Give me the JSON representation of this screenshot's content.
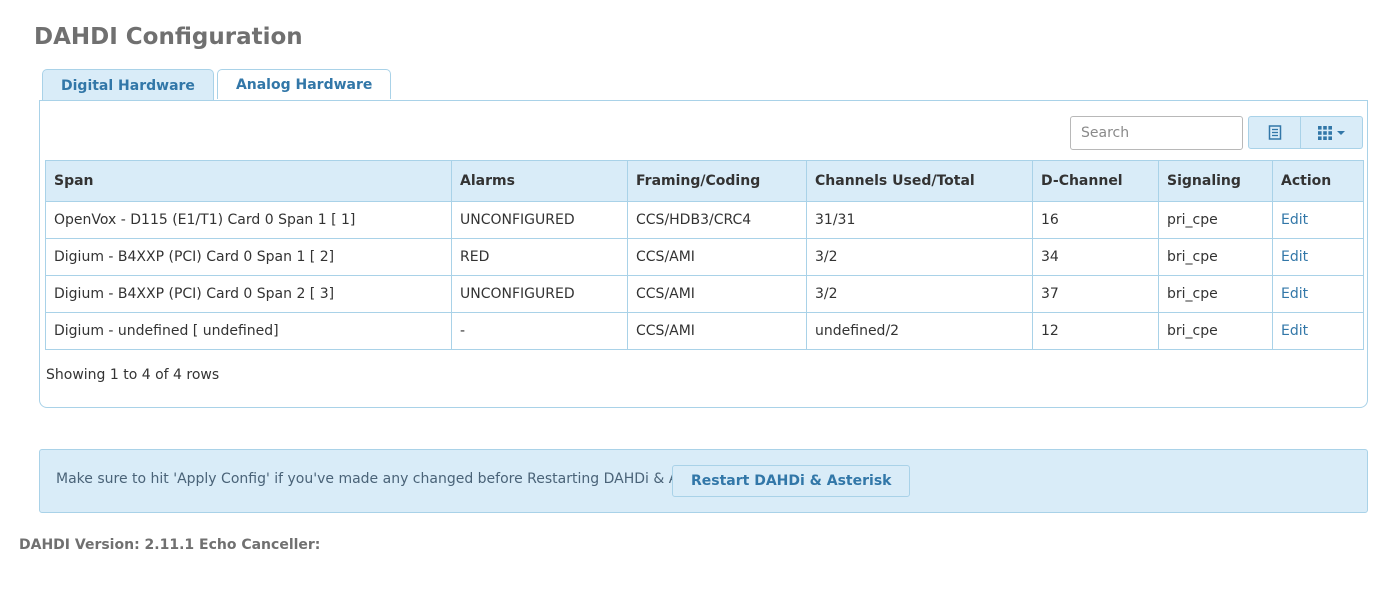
{
  "page": {
    "title": "DAHDI Configuration"
  },
  "tabs": [
    {
      "label": "Digital Hardware",
      "active": true
    },
    {
      "label": "Analog Hardware",
      "active": false
    }
  ],
  "toolbar": {
    "search_placeholder": "Search",
    "list_view_icon": "list-icon",
    "columns_icon": "grid-icon"
  },
  "table": {
    "headers": [
      "Span",
      "Alarms",
      "Framing/Coding",
      "Channels Used/Total",
      "D-Channel",
      "Signaling",
      "Action"
    ],
    "rows": [
      [
        "OpenVox - D115 (E1/T1) Card 0 Span 1 [ 1]",
        "UNCONFIGURED",
        "CCS/HDB3/CRC4",
        "31/31",
        "16",
        "pri_cpe",
        "Edit"
      ],
      [
        "Digium - B4XXP (PCI) Card 0 Span 1 [ 2]",
        "RED",
        "CCS/AMI",
        "3/2",
        "34",
        "bri_cpe",
        "Edit"
      ],
      [
        "Digium - B4XXP (PCI) Card 0 Span 2 [ 3]",
        "UNCONFIGURED",
        "CCS/AMI",
        "3/2",
        "37",
        "bri_cpe",
        "Edit"
      ],
      [
        "Digium - undefined [ undefined]",
        "-",
        "CCS/AMI",
        "undefined/2",
        "12",
        "bri_cpe",
        "Edit"
      ]
    ]
  },
  "pagination": {
    "info": "Showing 1 to 4 of 4 rows"
  },
  "notice": {
    "text": "Make sure to hit 'Apply Config' if you've made any changed before Restarting DAHDi & Asterisk",
    "button_label": "Restart DAHDi & Asterisk"
  },
  "footer": {
    "version": "DAHDI Version: 2.11.1 Echo Canceller:"
  },
  "colors": {
    "accent": "#3277a8",
    "header_bg": "#d9ecf8",
    "border": "#a9d2e8",
    "title": "#707070"
  }
}
